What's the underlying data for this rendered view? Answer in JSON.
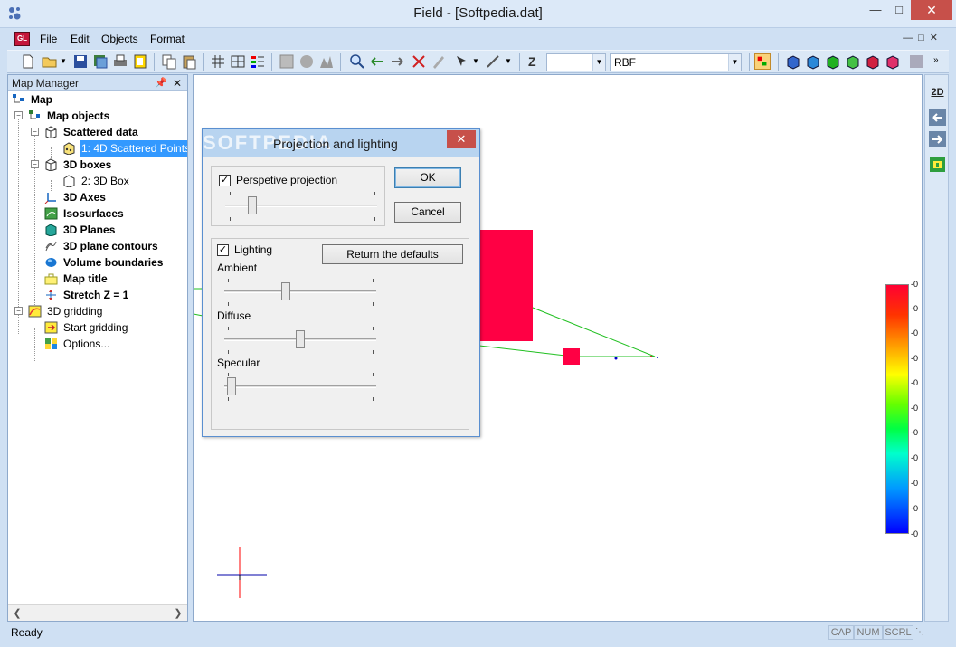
{
  "window": {
    "title": "Field - [Softpedia.dat]"
  },
  "menu": {
    "items": [
      "File",
      "Edit",
      "Objects",
      "Format"
    ]
  },
  "toolbar": {
    "z_label": "Z",
    "method_combo": "RBF"
  },
  "panel": {
    "title": "Map Manager",
    "tree": [
      {
        "label": "Map",
        "bold": true
      },
      {
        "label": "Map objects",
        "bold": true
      },
      {
        "label": "Scattered data",
        "bold": true
      },
      {
        "label": "1: 4D Scattered Points",
        "bold": false
      },
      {
        "label": "3D boxes",
        "bold": true
      },
      {
        "label": "2: 3D Box",
        "bold": false
      },
      {
        "label": "3D Axes",
        "bold": true
      },
      {
        "label": "Isosurfaces",
        "bold": true
      },
      {
        "label": "3D Planes",
        "bold": true
      },
      {
        "label": "3D plane contours",
        "bold": true
      },
      {
        "label": "Volume boundaries",
        "bold": true
      },
      {
        "label": "Map title",
        "bold": true
      },
      {
        "label": "Stretch Z = 1",
        "bold": true
      },
      {
        "label": "3D gridding",
        "bold": false
      },
      {
        "label": "Start gridding",
        "bold": false
      },
      {
        "label": "Options...",
        "bold": false
      }
    ]
  },
  "dialog": {
    "title": "Projection and lighting",
    "watermark": "SOFTPEDIA",
    "perspective_label": "Perspetive projection",
    "perspective_checked": true,
    "perspective_value": 0.16,
    "ok_label": "OK",
    "cancel_label": "Cancel",
    "lighting_label": "Lighting",
    "lighting_checked": true,
    "defaults_label": "Return the defaults",
    "ambient_label": "Ambient",
    "ambient_value": 0.4,
    "diffuse_label": "Diffuse",
    "diffuse_value": 0.5,
    "specular_label": "Specular",
    "specular_value": 0.02
  },
  "colorscale": {
    "ticks": [
      "-0",
      "-0",
      "-0",
      "-0",
      "-0",
      "-0",
      "-0",
      "-0",
      "-0",
      "-0",
      "-0"
    ]
  },
  "rstrip": {
    "mode_label": "2D"
  },
  "status": {
    "ready": "Ready",
    "cap": "CAP",
    "num": "NUM",
    "scrl": "SCRL"
  }
}
